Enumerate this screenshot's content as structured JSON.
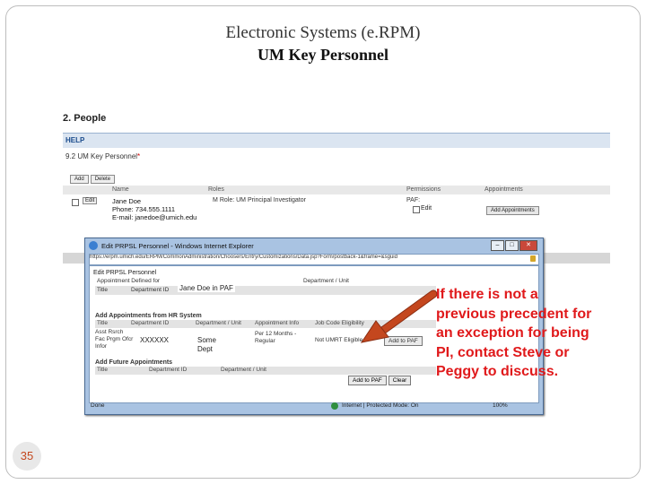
{
  "slide": {
    "title_line1": "Electronic Systems (e.RPM)",
    "title_line2": "UM Key Personnel",
    "page_number": "35",
    "callout_text": "If there is not a previous precedent for an exception for being PI, contact Steve or Peggy to discuss.",
    "callout_color": "#e0191b",
    "arrow_color": "#c4471e"
  },
  "erpm": {
    "section_heading": "2. People",
    "help_label": "HELP",
    "subsection_title": "9.2 UM Key Personnel",
    "required_mark": "*",
    "buttons": {
      "add": "Add",
      "delete": "Delete"
    },
    "columns": {
      "name": "Name",
      "roles": "Roles",
      "permissions": "Permissions",
      "appointments": "Appointments"
    },
    "row": {
      "edit_label": "Edit",
      "person_name": "Jane Doe",
      "person_phone": "Phone: 734.555.1111",
      "person_email": "E-mail: janedoe@umich.edu",
      "role": "UM Role: UM Principal Investigator",
      "paf_label": "PAF:",
      "edit_checkbox_label": "Edit",
      "add_appointment_label": "Add Appointments"
    }
  },
  "popup": {
    "window_title": "Edit PRPSL Personnel - Windows Internet Explorer",
    "url": "https://erpm.umich.edu/ERPM/CommonAdministration/Choosers/Entry/Customizations/Data.jsp?Form/postback-1&frame=&sguid",
    "page_title": "Edit PRPSL Personnel",
    "table1_header": {
      "appointments_defined_for": "Appointment Defined for",
      "title": "Title",
      "department_id": "Department ID",
      "department_unit": "Department / Unit"
    },
    "pi_name": "Jane Doe in PAF",
    "hr_section_title": "Add Appointments from HR System",
    "hr_columns": {
      "title": "Title",
      "department_id": "Department ID",
      "department_unit": "Department / Unit",
      "appointment_info": "Appointment Info",
      "job_code_eligibility": "Job Code Eligibility"
    },
    "hr_row": {
      "title_lines": "Asst Rsrch Fac Prgm Ofcr Infor",
      "dept_id": "XXXXXX",
      "dept_name_line1": "Some",
      "dept_name_line2": "Dept",
      "appointment_line1": "Per 12 Months -",
      "appointment_line2": "Regular",
      "eligibility": "Not UMRT Eligible",
      "add_to_paf": "Add to PAF"
    },
    "future_section_title": "Add Future Appointments",
    "future_columns": {
      "title": "Title",
      "department_id": "Department ID",
      "department_unit": "Department / Unit"
    },
    "future_buttons": {
      "add_to_paf": "Add to PAF",
      "clear": "Clear"
    },
    "status_done": "Done",
    "status_zone": "Internet | Protected Mode: On",
    "status_zoom": "100%"
  }
}
